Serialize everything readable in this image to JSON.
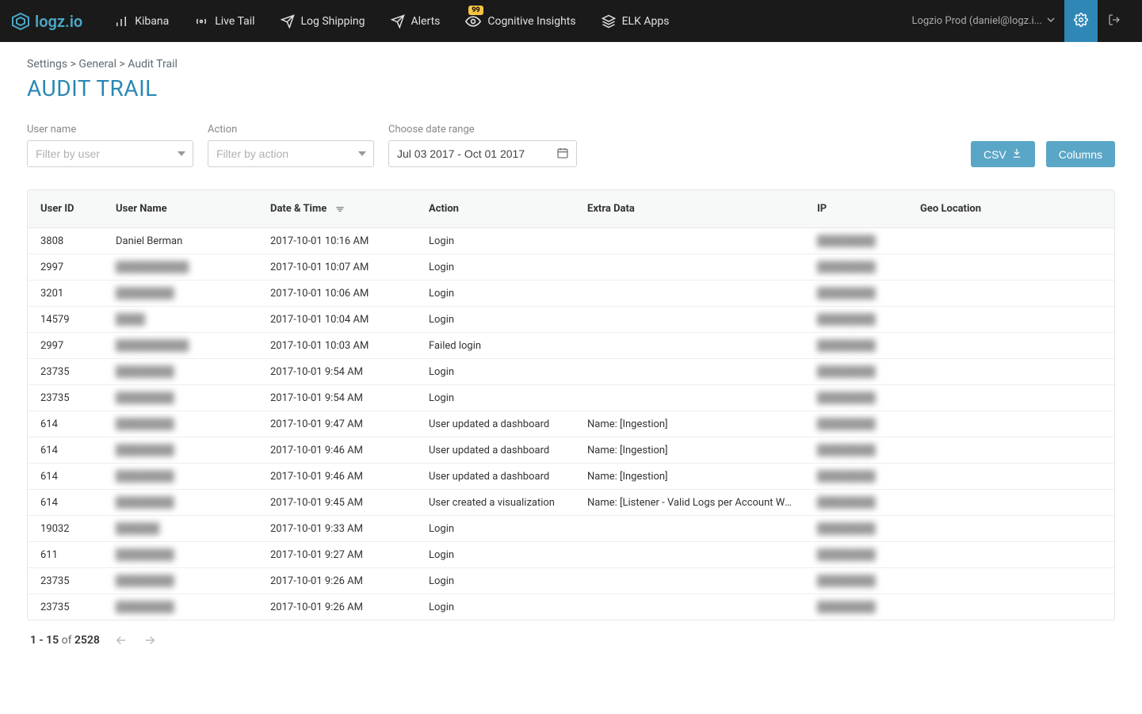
{
  "brand": "logz.io",
  "nav": {
    "kibana": "Kibana",
    "livetail": "Live Tail",
    "logshipping": "Log Shipping",
    "alerts": "Alerts",
    "cognitive": "Cognitive Insights",
    "cognitive_badge": "99",
    "elkapps": "ELK Apps"
  },
  "account_label": "Logzio Prod (daniel@logz.i...",
  "breadcrumb": {
    "p1": "Settings",
    "sep1": " > ",
    "p2": "General",
    "sep2": " > ",
    "p3": "Audit Trail"
  },
  "page_title": "AUDIT TRAIL",
  "filters": {
    "user_label": "User name",
    "user_placeholder": "Filter by user",
    "action_label": "Action",
    "action_placeholder": "Filter by action",
    "date_label": "Choose date range",
    "date_value": "Jul 03 2017 - Oct 01 2017",
    "csv_label": "CSV",
    "columns_label": "Columns"
  },
  "columns": {
    "user_id": "User ID",
    "user_name": "User Name",
    "datetime": "Date & Time",
    "action": "Action",
    "extra": "Extra Data",
    "ip": "IP",
    "geo": "Geo Location"
  },
  "rows": [
    {
      "user_id": "3808",
      "user_name": "Daniel Berman",
      "user_blur": false,
      "datetime": "2017-10-01 10:16 AM",
      "action": "Login",
      "extra": "",
      "ip": "████████"
    },
    {
      "user_id": "2997",
      "user_name": "██████████",
      "user_blur": true,
      "datetime": "2017-10-01 10:07 AM",
      "action": "Login",
      "extra": "",
      "ip": "████████"
    },
    {
      "user_id": "3201",
      "user_name": "████████",
      "user_blur": true,
      "datetime": "2017-10-01 10:06 AM",
      "action": "Login",
      "extra": "",
      "ip": "████████"
    },
    {
      "user_id": "14579",
      "user_name": "████",
      "user_blur": true,
      "datetime": "2017-10-01 10:04 AM",
      "action": "Login",
      "extra": "",
      "ip": "████████"
    },
    {
      "user_id": "2997",
      "user_name": "██████████",
      "user_blur": true,
      "datetime": "2017-10-01 10:03 AM",
      "action": "Failed login",
      "extra": "",
      "ip": "████████"
    },
    {
      "user_id": "23735",
      "user_name": "████████",
      "user_blur": true,
      "datetime": "2017-10-01 9:54 AM",
      "action": "Login",
      "extra": "",
      "ip": "████████"
    },
    {
      "user_id": "23735",
      "user_name": "████████",
      "user_blur": true,
      "datetime": "2017-10-01 9:54 AM",
      "action": "Login",
      "extra": "",
      "ip": "████████"
    },
    {
      "user_id": "614",
      "user_name": "████████",
      "user_blur": true,
      "datetime": "2017-10-01 9:47 AM",
      "action": "User updated a dashboard",
      "extra": "Name: [Ingestion]",
      "ip": "████████"
    },
    {
      "user_id": "614",
      "user_name": "████████",
      "user_blur": true,
      "datetime": "2017-10-01 9:46 AM",
      "action": "User updated a dashboard",
      "extra": "Name: [Ingestion]",
      "ip": "████████"
    },
    {
      "user_id": "614",
      "user_name": "████████",
      "user_blur": true,
      "datetime": "2017-10-01 9:46 AM",
      "action": "User updated a dashboard",
      "extra": "Name: [Ingestion]",
      "ip": "████████"
    },
    {
      "user_id": "614",
      "user_name": "████████",
      "user_blur": true,
      "datetime": "2017-10-01 9:45 AM",
      "action": "User created a visualization",
      "extra": "Name: [Listener - Valid Logs per Account With N...",
      "ip": "████████"
    },
    {
      "user_id": "19032",
      "user_name": "██████",
      "user_blur": true,
      "datetime": "2017-10-01 9:33 AM",
      "action": "Login",
      "extra": "",
      "ip": "████████"
    },
    {
      "user_id": "611",
      "user_name": "████████",
      "user_blur": true,
      "datetime": "2017-10-01 9:27 AM",
      "action": "Login",
      "extra": "",
      "ip": "████████"
    },
    {
      "user_id": "23735",
      "user_name": "████████",
      "user_blur": true,
      "datetime": "2017-10-01 9:26 AM",
      "action": "Login",
      "extra": "",
      "ip": "████████"
    },
    {
      "user_id": "23735",
      "user_name": "████████",
      "user_blur": true,
      "datetime": "2017-10-01 9:26 AM",
      "action": "Login",
      "extra": "",
      "ip": "████████"
    }
  ],
  "pagination": {
    "range": "1 - 15",
    "of": "of",
    "total": "2528"
  }
}
